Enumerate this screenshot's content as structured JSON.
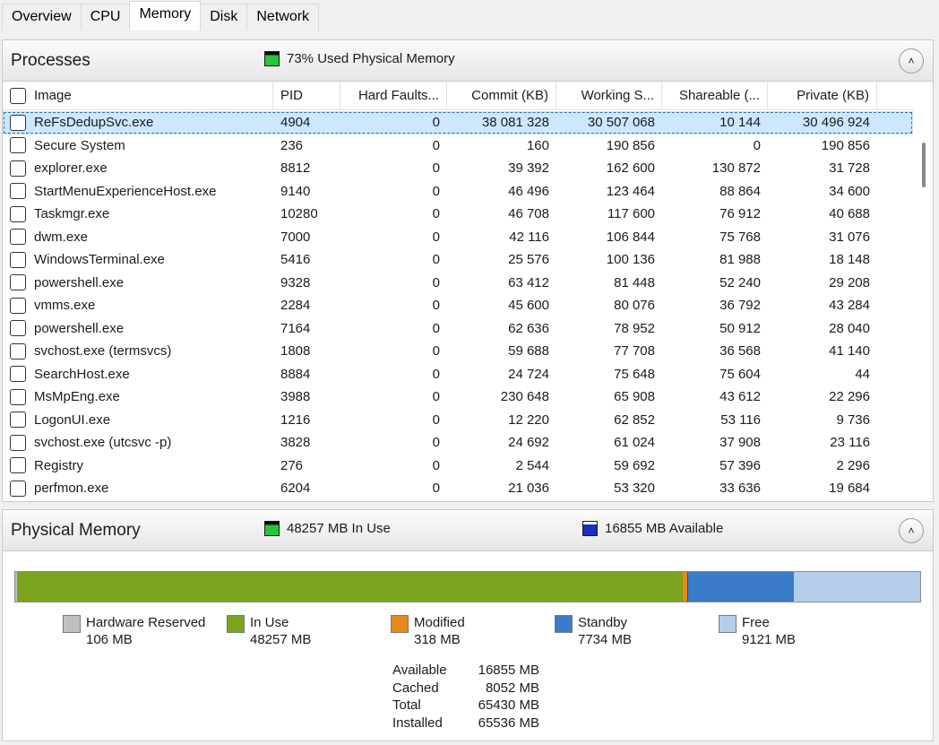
{
  "tabs": [
    {
      "label": "Overview"
    },
    {
      "label": "CPU"
    },
    {
      "label": "Memory",
      "active": true
    },
    {
      "label": "Disk"
    },
    {
      "label": "Network"
    }
  ],
  "processes": {
    "title": "Processes",
    "summary": "73% Used Physical Memory",
    "columns": [
      "Image",
      "PID",
      "Hard Faults...",
      "Commit (KB)",
      "Working S...",
      "Shareable (...",
      "Private (KB)"
    ],
    "rows": [
      [
        "ReFsDedupSvc.exe",
        "4904",
        "0",
        "38 081 328",
        "30 507 068",
        "10 144",
        "30 496 924"
      ],
      [
        "Secure System",
        "236",
        "0",
        "160",
        "190 856",
        "0",
        "190 856"
      ],
      [
        "explorer.exe",
        "8812",
        "0",
        "39 392",
        "162 600",
        "130 872",
        "31 728"
      ],
      [
        "StartMenuExperienceHost.exe",
        "9140",
        "0",
        "46 496",
        "123 464",
        "88 864",
        "34 600"
      ],
      [
        "Taskmgr.exe",
        "10280",
        "0",
        "46 708",
        "117 600",
        "76 912",
        "40 688"
      ],
      [
        "dwm.exe",
        "7000",
        "0",
        "42 116",
        "106 844",
        "75 768",
        "31 076"
      ],
      [
        "WindowsTerminal.exe",
        "5416",
        "0",
        "25 576",
        "100 136",
        "81 988",
        "18 148"
      ],
      [
        "powershell.exe",
        "9328",
        "0",
        "63 412",
        "81 448",
        "52 240",
        "29 208"
      ],
      [
        "vmms.exe",
        "2284",
        "0",
        "45 600",
        "80 076",
        "36 792",
        "43 284"
      ],
      [
        "powershell.exe",
        "7164",
        "0",
        "62 636",
        "78 952",
        "50 912",
        "28 040"
      ],
      [
        "svchost.exe (termsvcs)",
        "1808",
        "0",
        "59 688",
        "77 708",
        "36 568",
        "41 140"
      ],
      [
        "SearchHost.exe",
        "8884",
        "0",
        "24 724",
        "75 648",
        "75 604",
        "44"
      ],
      [
        "MsMpEng.exe",
        "3988",
        "0",
        "230 648",
        "65 908",
        "43 612",
        "22 296"
      ],
      [
        "LogonUI.exe",
        "1216",
        "0",
        "12 220",
        "62 852",
        "53 116",
        "9 736"
      ],
      [
        "svchost.exe (utcsvc -p)",
        "3828",
        "0",
        "24 692",
        "61 024",
        "37 908",
        "23 116"
      ],
      [
        "Registry",
        "276",
        "0",
        "2 544",
        "59 692",
        "57 396",
        "2 296"
      ],
      [
        "perfmon.exe",
        "6204",
        "0",
        "21 036",
        "53 320",
        "33 636",
        "19 684"
      ]
    ],
    "selected_row": 0
  },
  "physical_memory": {
    "title": "Physical Memory",
    "in_use_summary": "48257 MB In Use",
    "available_summary": "16855 MB Available",
    "legend": [
      {
        "label": "Hardware Reserved",
        "value": "106 MB",
        "color": "#c0c0c0"
      },
      {
        "label": "In Use",
        "value": "48257 MB",
        "color": "#7aa41e"
      },
      {
        "label": "Modified",
        "value": "318 MB",
        "color": "#e8891c"
      },
      {
        "label": "Standby",
        "value": "7734 MB",
        "color": "#3a7cc8"
      },
      {
        "label": "Free",
        "value": "9121 MB",
        "color": "#b5cdeb"
      }
    ],
    "bar_mb": {
      "hardware_reserved": 106,
      "in_use": 48257,
      "modified": 318,
      "standby": 7734,
      "free": 9121
    },
    "stats": [
      {
        "label": "Available",
        "value": "16855 MB"
      },
      {
        "label": "Cached",
        "value": "8052 MB"
      },
      {
        "label": "Total",
        "value": "65430 MB"
      },
      {
        "label": "Installed",
        "value": "65536 MB"
      }
    ]
  },
  "colors": {
    "selection": "#cce8ff",
    "accent": "#3a6ea5"
  }
}
